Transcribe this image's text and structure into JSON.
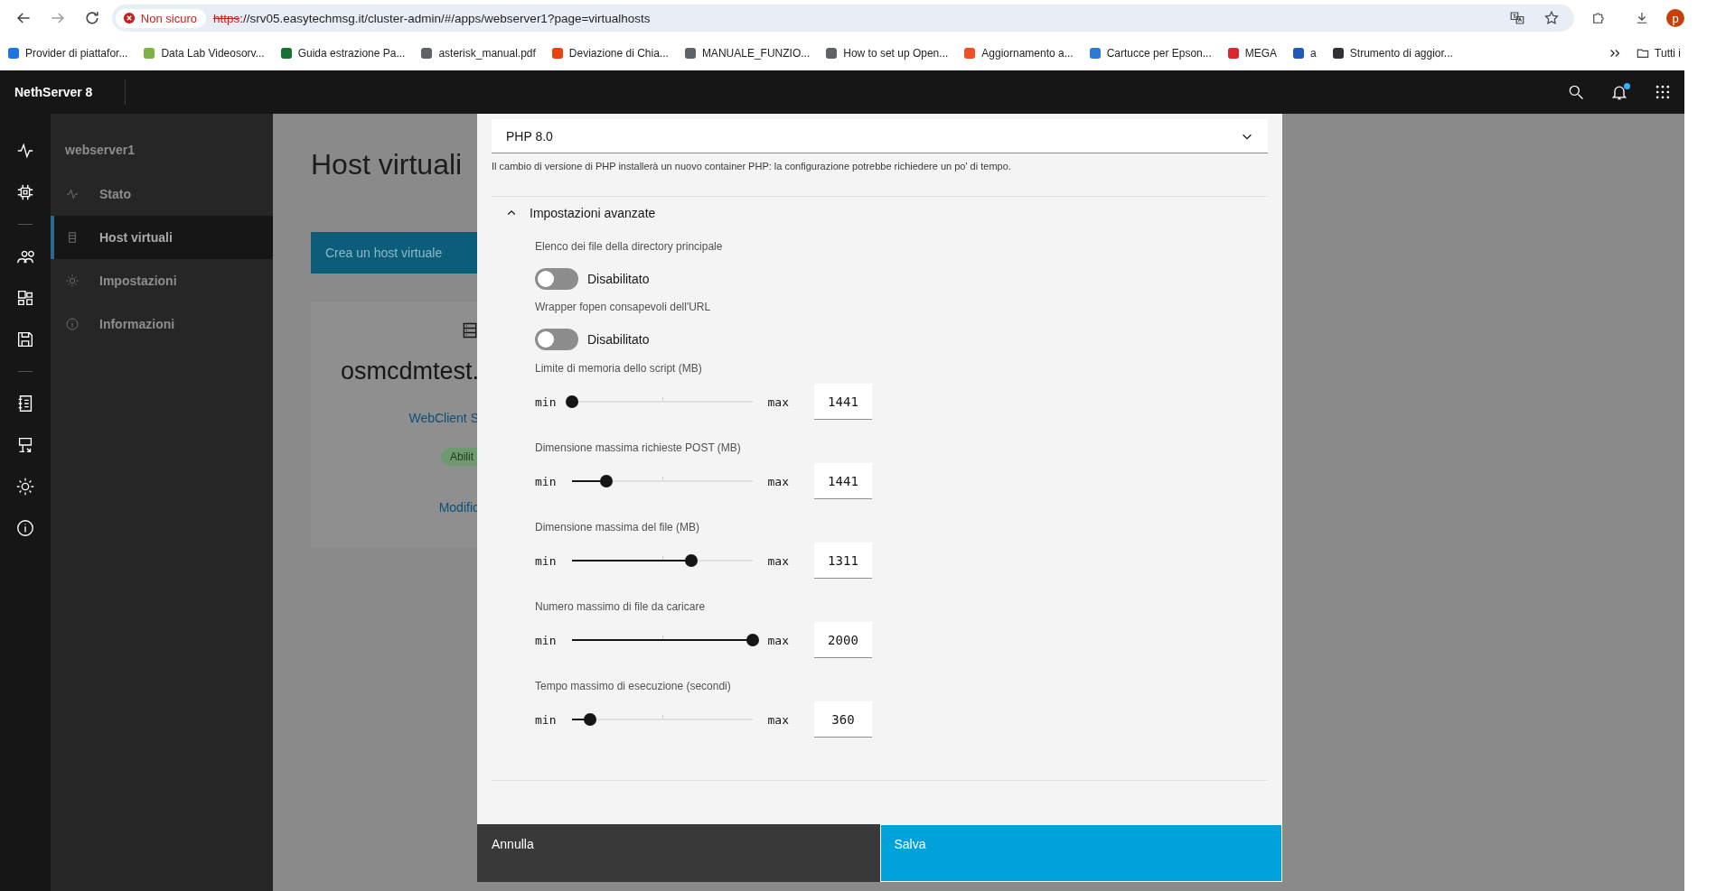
{
  "browser": {
    "security": "Non sicuro",
    "url_scheme": "https",
    "url_rest": "://srv05.easytechmsg.it/cluster-admin/#/apps/webserver1?page=virtualhosts",
    "bookmarks": [
      {
        "label": "Provider di piattafor...",
        "color": "#1a73e8"
      },
      {
        "label": "Data Lab Videosorv...",
        "color": "#7cb342"
      },
      {
        "label": "Guida estrazione Pa...",
        "color": "#137333"
      },
      {
        "label": "asterisk_manual.pdf",
        "color": "#5f6368"
      },
      {
        "label": "Deviazione di Chia...",
        "color": "#e8430a"
      },
      {
        "label": "MANUALE_FUNZIO...",
        "color": "#5f6368"
      },
      {
        "label": "How to set up Open...",
        "color": "#5f6368"
      },
      {
        "label": "Aggiornamento a...",
        "color": "#f25022"
      },
      {
        "label": "Cartucce per Epson...",
        "color": "#2a7bd6"
      },
      {
        "label": "MEGA",
        "color": "#d9272e"
      },
      {
        "label": "a",
        "color": "#1e5bb8"
      },
      {
        "label": "Strumento di aggior...",
        "color": "#303134"
      }
    ],
    "folder": "Tutti i",
    "profile": "p"
  },
  "app": {
    "title": "NethServer 8",
    "notification": true
  },
  "sidebar": {
    "app_name": "webserver1",
    "items": [
      {
        "label": "Stato",
        "selected": false
      },
      {
        "label": "Host virtuali",
        "selected": true
      },
      {
        "label": "Impostazioni",
        "selected": false
      },
      {
        "label": "Informazioni",
        "selected": false
      }
    ]
  },
  "page": {
    "title": "Host virtuali",
    "create_button": "Crea un host virtuale",
    "card": {
      "hostname": "osmcdmtest.",
      "link": "WebClient S",
      "status": "Abilit",
      "edit": "Modific"
    }
  },
  "modal": {
    "php_select": {
      "value": "PHP 8.0"
    },
    "php_help": "Il cambio di versione di PHP installerà un nuovo container PHP: la configurazione potrebbe richiedere un po' di tempo.",
    "advanced": {
      "title": "Impostazioni avanzate",
      "expanded": true,
      "settings": [
        {
          "kind": "toggle",
          "label": "Elenco dei file della directory principale",
          "on": false,
          "state_label": "Disabilitato"
        },
        {
          "kind": "toggle",
          "label": "Wrapper fopen consapevoli dell'URL",
          "on": false,
          "state_label": "Disabilitato"
        },
        {
          "kind": "slider",
          "label": "Limite di memoria dello script (MB)",
          "level": 0,
          "min_label": "min",
          "max_label": "max",
          "value": "1441"
        },
        {
          "kind": "slider",
          "label": "Dimensione massima richieste POST (MB)",
          "level": 0.19,
          "min_label": "min",
          "max_label": "max",
          "value": "1441"
        },
        {
          "kind": "slider",
          "label": "Dimensione massima del file (MB)",
          "level": 0.66,
          "min_label": "min",
          "max_label": "max",
          "value": "1311"
        },
        {
          "kind": "slider",
          "label": "Numero massimo di file da caricare",
          "level": 1,
          "min_label": "min",
          "max_label": "max",
          "value": "2000"
        },
        {
          "kind": "slider",
          "label": "Tempo massimo di esecuzione (secondi)",
          "level": 0.1,
          "min_label": "min",
          "max_label": "max",
          "value": "360"
        }
      ]
    },
    "cancel": "Annulla",
    "save": "Salva"
  }
}
